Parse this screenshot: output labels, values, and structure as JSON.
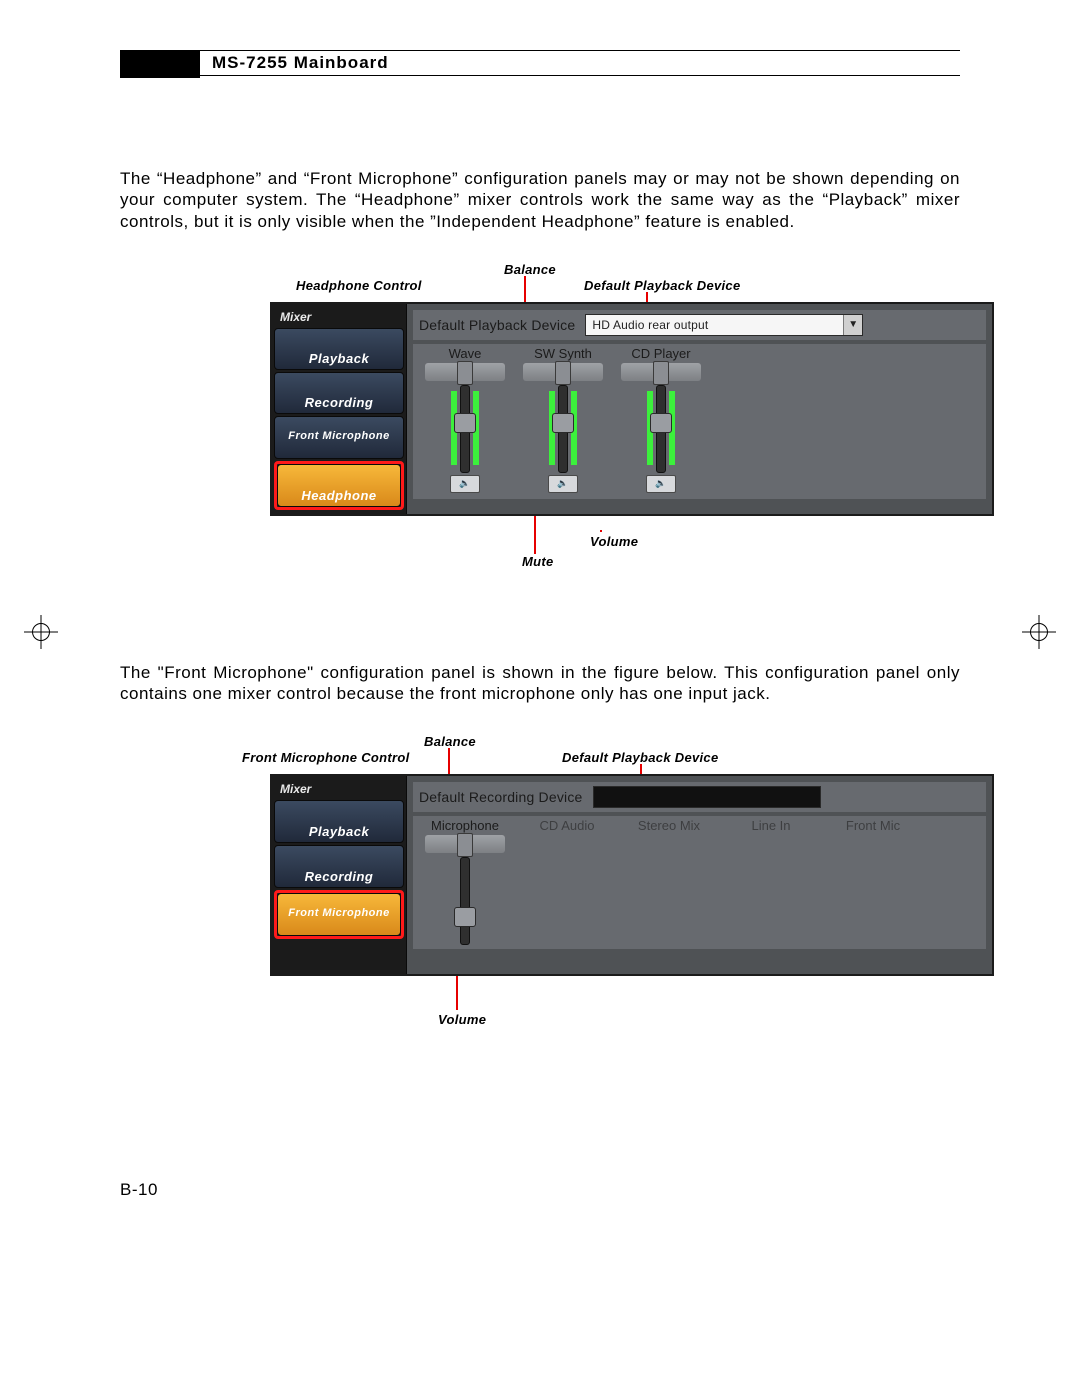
{
  "header": {
    "title": "MS-7255 Mainboard"
  },
  "para1": "The “Headphone”  and “Front Microphone” configuration panels may or may not be shown depending on your computer system. The “Headphone” mixer controls work the same way as the “Playback” mixer controls, but it is only visible when the ”Independent Headphone” feature is enabled.",
  "para2": "The \"Front Microphone\" configuration panel is shown in the figure below. This configuration panel only contains one mixer control because the front microphone only has one input jack.",
  "fig1": {
    "annot_headphone_control": "Headphone Control",
    "annot_balance": "Balance",
    "annot_default_dev": "Default Playback Device",
    "annot_volume": "Volume",
    "annot_mute": "Mute",
    "mixer_label": "Mixer",
    "side_playback": "Playback",
    "side_recording": "Recording",
    "side_front_mic": "Front Microphone",
    "side_headphone": "Headphone",
    "default_label": "Default Playback Device",
    "default_value": "HD Audio rear output",
    "ch_wave": "Wave",
    "ch_swsynth": "SW Synth",
    "ch_cd": "CD Player"
  },
  "fig2": {
    "annot_front_mic_control": "Front Microphone Control",
    "annot_balance": "Balance",
    "annot_default_dev": "Default Playback Device",
    "annot_volume": "Volume",
    "mixer_label": "Mixer",
    "side_playback": "Playback",
    "side_recording": "Recording",
    "side_front_mic": "Front Microphone",
    "default_label": "Default Recording Device",
    "ch_mic": "Microphone",
    "ch_cdaudio": "CD Audio",
    "ch_stereo": "Stereo Mix",
    "ch_linein": "Line In",
    "ch_frontmic": "Front Mic"
  },
  "page_number": "B-10"
}
